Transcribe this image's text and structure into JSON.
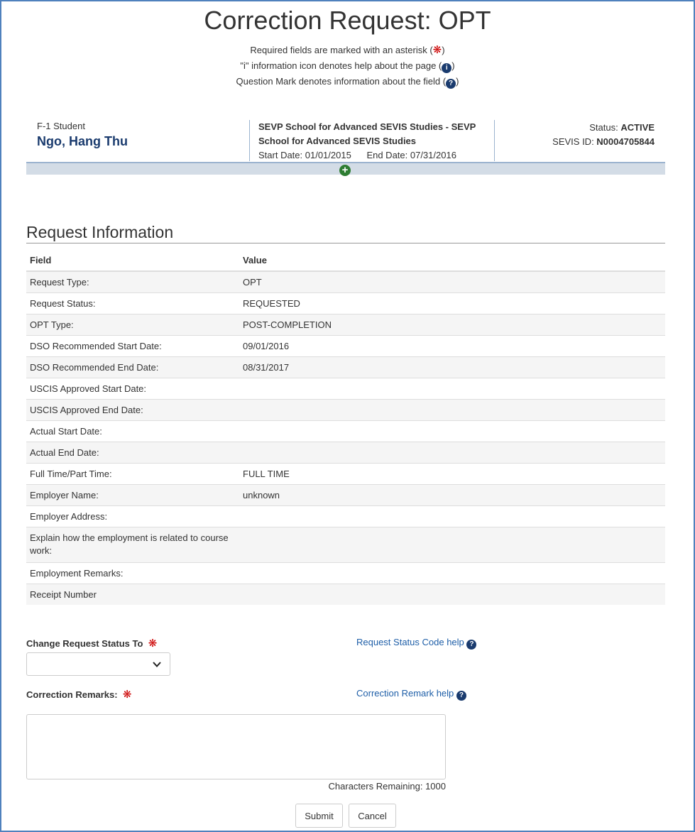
{
  "page": {
    "title": "Correction Request: OPT",
    "help_required_prefix": "Required fields are marked with an asterisk (",
    "help_required_suffix": ")",
    "help_info_prefix": "\"i\" information icon denotes help about the page (",
    "help_info_suffix": ")",
    "help_question_prefix": "Question Mark denotes information about the field (",
    "help_question_suffix": ")"
  },
  "student": {
    "type": "F-1 Student",
    "name": "Ngo, Hang Thu",
    "school": "SEVP School for Advanced SEVIS Studies - SEVP School for Advanced SEVIS Studies",
    "start_date": "Start Date: 01/01/2015",
    "end_date": "End Date: 07/31/2016",
    "status_label": "Status: ",
    "status_value": "ACTIVE",
    "sevis_label": "SEVIS ID: ",
    "sevis_value": "N0004705844"
  },
  "request_info": {
    "heading": "Request Information",
    "col_field": "Field",
    "col_value": "Value",
    "rows": [
      {
        "field": "Request Type:",
        "value": "OPT"
      },
      {
        "field": "Request Status:",
        "value": "REQUESTED"
      },
      {
        "field": "OPT Type:",
        "value": "POST-COMPLETION"
      },
      {
        "field": "DSO Recommended Start Date:",
        "value": "09/01/2016"
      },
      {
        "field": "DSO Recommended End Date:",
        "value": "08/31/2017"
      },
      {
        "field": "USCIS Approved Start Date:",
        "value": ""
      },
      {
        "field": "USCIS Approved End Date:",
        "value": ""
      },
      {
        "field": "Actual Start Date:",
        "value": ""
      },
      {
        "field": "Actual End Date:",
        "value": ""
      },
      {
        "field": "Full Time/Part Time:",
        "value": "FULL TIME"
      },
      {
        "field": "Employer Name:",
        "value": "unknown"
      },
      {
        "field": "Employer Address:",
        "value": ""
      },
      {
        "field": "Explain how the employment is related to course work:",
        "value": ""
      },
      {
        "field": "Employment Remarks:",
        "value": ""
      },
      {
        "field": "Receipt Number",
        "value": ""
      }
    ]
  },
  "form": {
    "status_label": "Change Request Status To",
    "status_help": "Request Status Code help",
    "status_selected": "",
    "remarks_label": "Correction Remarks:",
    "remarks_help": "Correction Remark help",
    "remarks_value": "",
    "chars_remaining": "Characters Remaining: 1000",
    "submit_label": "Submit",
    "cancel_label": "Cancel"
  },
  "icons": {
    "required": "asterisk-icon",
    "info": "info-circle-icon",
    "question": "question-circle-icon",
    "expand": "plus-circle-icon",
    "dropdown": "chevron-down-icon"
  },
  "colors": {
    "frame": "#4f81bd",
    "student_name": "#1a3b6e",
    "required_star": "#cc0000",
    "link": "#1f5fa8",
    "expand_icon": "#2e7d32",
    "banner_bar": "#d3dce6"
  }
}
